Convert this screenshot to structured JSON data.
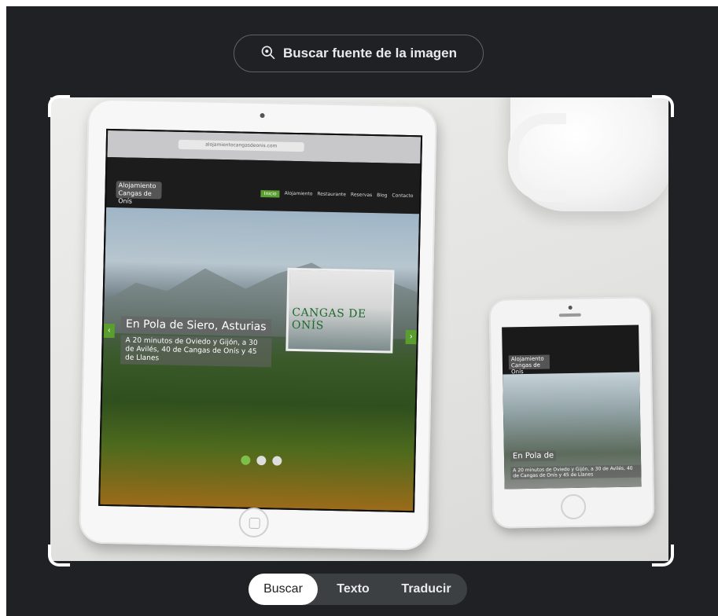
{
  "header": {
    "source_button_label": "Buscar fuente de la imagen",
    "source_icon": "image-search-icon"
  },
  "photo": {
    "ipad": {
      "url": "alojamientocangasdeonis.com",
      "logo_line1": "Alojamiento",
      "logo_line2": "Cangas de Onís",
      "nav": [
        "Inicio",
        "Alojamiento",
        "Restaurante",
        "Reservas",
        "Blog",
        "Contacto"
      ],
      "hero_title": "En Pola de Siero, Asturias",
      "hero_text": "A 20 minutos de Oviedo y Gijón, a 30 de Avilés, 40 de Cangas de Onís y 45 de Llanes",
      "card_text": "CANGAS DE ONÍS"
    },
    "iphone": {
      "logo_line1": "Alojamiento",
      "logo_line2": "Cangas de Onís",
      "hero_title": "En Pola de",
      "hero_text": "A 20 minutos de Oviedo y Gijón, a 30 de Avilés, 40 de Cangas de Onís y 45 de Llanes"
    }
  },
  "tabs": [
    {
      "label": "Buscar",
      "active": true
    },
    {
      "label": "Texto",
      "active": false
    },
    {
      "label": "Traducir",
      "active": false
    }
  ],
  "colors": {
    "panel_bg": "#202124",
    "tab_bar_bg": "#3c4043",
    "accent_green": "#5a9e2f"
  }
}
